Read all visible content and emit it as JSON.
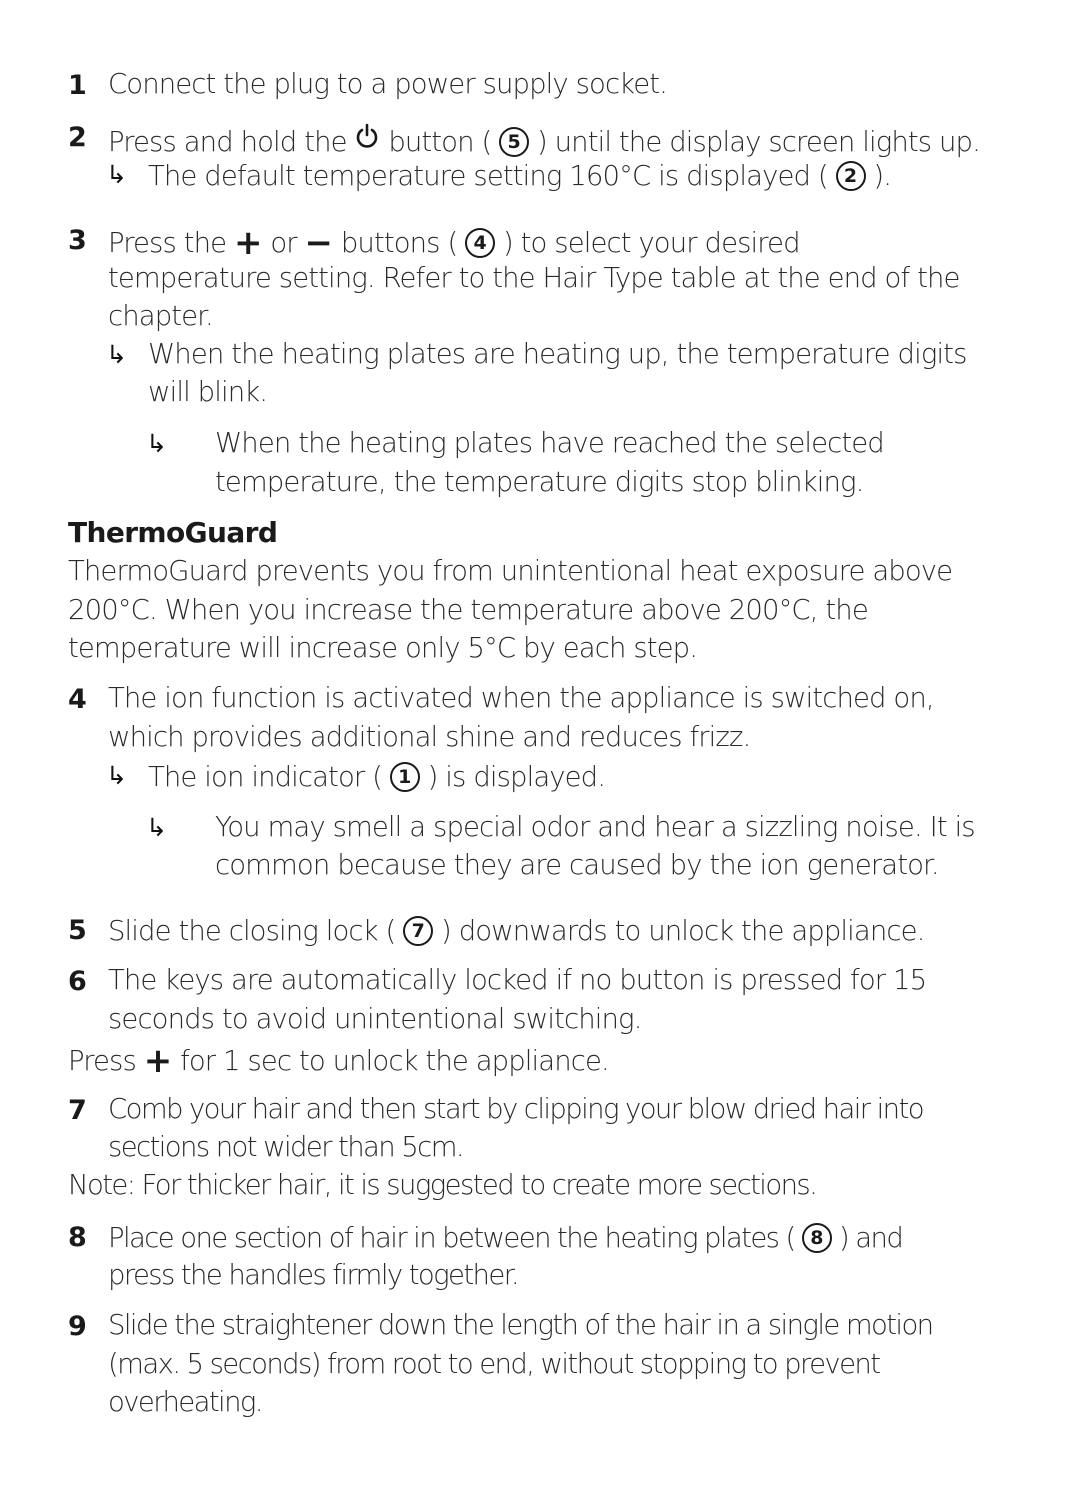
{
  "steps": {
    "s1": {
      "num": "1",
      "text": "Connect the plug to a power supply socket."
    },
    "s2": {
      "num": "2",
      "a": "Press and hold the",
      "b": "button (",
      "circle": "5",
      "c": ") until the display screen lights up.",
      "result_a": "The default temperature setting 160°C is displayed (",
      "result_circle": "2",
      "result_b": ")."
    },
    "s3": {
      "num": "3",
      "a": "Press the",
      "plus": "+",
      "or": "or",
      "minus": "−",
      "b": "buttons (",
      "circle": "4",
      "c": ") to select your desired",
      "line2": "temperature setting. Refer to the Hair Type table at the end of the",
      "line3": "chapter.",
      "result1_l1": "When the heating plates are heating up, the temperature digits",
      "result1_l2": "will blink.",
      "result2_l1": "When the heating plates have reached the selected",
      "result2_l2": "temperature, the temperature digits stop blinking."
    },
    "thermoguard": {
      "heading": "ThermoGuard",
      "l1": "ThermoGuard prevents you from unintentional heat exposure above",
      "l2": "200°C. When you increase the temperature above 200°C, the",
      "l3": "temperature will increase only 5°C by each step."
    },
    "s4": {
      "num": "4",
      "l1": "The ion function is activated when the appliance is switched on,",
      "l2": "which provides additional shine and reduces frizz.",
      "result1_a": "The ion indicator (",
      "result1_circle": "1",
      "result1_b": ") is displayed.",
      "result2_l1": "You may smell a special odor and hear a sizzling noise. It is",
      "result2_l2": "common because they are caused by the ion generator."
    },
    "s5": {
      "num": "5",
      "a": "Slide the closing lock (",
      "circle": "7",
      "b": ") downwards to unlock the appliance."
    },
    "s6": {
      "num": "6",
      "l1": "The keys are automatically locked if no button is pressed for 15",
      "l2": "seconds to avoid unintentional switching.",
      "press_a": "Press",
      "press_plus": "+",
      "press_b": "for 1 sec to unlock the appliance."
    },
    "s7": {
      "num": "7",
      "l1": "Comb your hair and then start by clipping your blow dried hair into",
      "l2": "sections not wider than 5cm.",
      "note": "Note: For thicker hair, it is suggested to create more sections."
    },
    "s8": {
      "num": "8",
      "a": "Place one section of hair in between the heating plates (",
      "circle": "8",
      "b": ") and",
      "l2": "press the handles firmly together."
    },
    "s9": {
      "num": "9",
      "l1": "Slide the straightener down the length of the hair in a single motion",
      "l2": "(max. 5 seconds) from root to end, without stopping to prevent",
      "l3": "overheating."
    },
    "arrow_glyph": "↳"
  }
}
